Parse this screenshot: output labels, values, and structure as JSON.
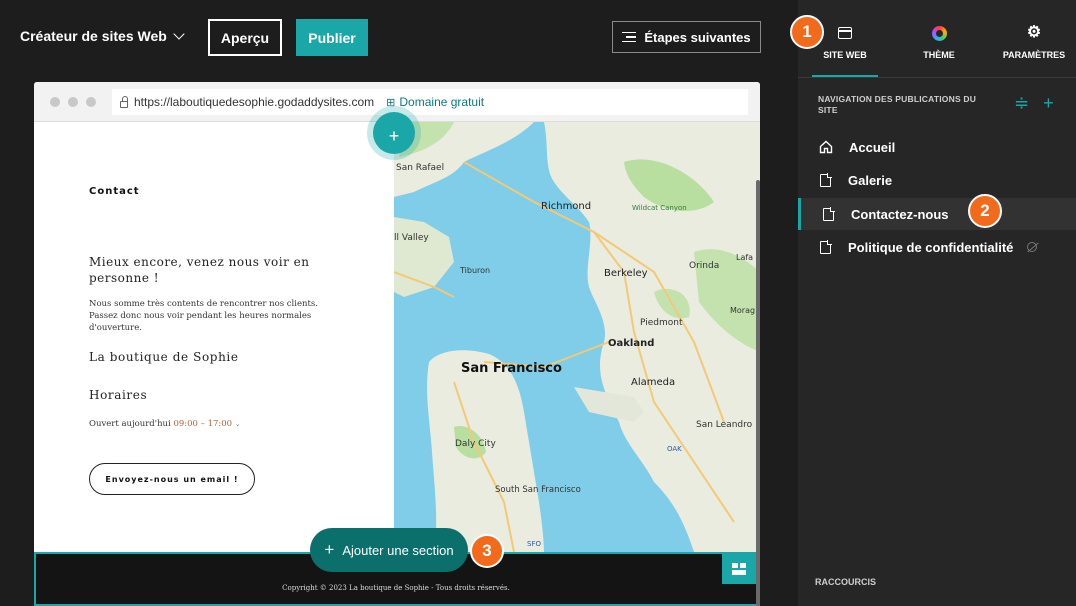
{
  "topbar": {
    "builder_title": "Créateur de sites Web",
    "preview_label": "Aperçu",
    "publish_label": "Publier",
    "next_steps_label": "Étapes suivantes"
  },
  "browser": {
    "url": "https://laboutiquedesophie.godaddysites.com",
    "domain_label": "Domaine gratuit"
  },
  "page": {
    "contact_heading": "Contact",
    "title": "Mieux encore, venez nous voir en personne !",
    "text": "Nous somme très contents de rencontrer nos clients. Passez donc nous voir pendant les heures normales d'ouverture.",
    "shop_name": "La boutique de Sophie",
    "hours_heading": "Horaires",
    "open_today": "Ouvert aujourd'hui",
    "open_time": "09:00 – 17:00",
    "email_button": "Envoyez-nous un email !",
    "footer_text": "Copyright © 2023 La boutique de Sophie - Tous droits réservés.",
    "add_section_label": "Ajouter une section"
  },
  "map": {
    "labels": {
      "san_rafael": "San Rafael",
      "richmond": "Richmond",
      "wildcat": "Wildcat Canyon",
      "tiburon": "Tiburon",
      "berkeley": "Berkeley",
      "orinda": "Orinda",
      "lafa": "Lafa",
      "piedmont": "Piedmont",
      "moraga": "Morag",
      "oakland": "Oakland",
      "san_francisco": "San Francisco",
      "alameda": "Alameda",
      "san_leandro": "San Leandro",
      "daly_city": "Daly City",
      "south_sf": "South San Francisco",
      "mill_valley": "ll Valley",
      "oak": "OAK",
      "sfo": "SFO"
    }
  },
  "panel": {
    "tabs": [
      {
        "label": "SITE WEB"
      },
      {
        "label": "THÈME"
      },
      {
        "label": "PARAMÈTRES"
      }
    ],
    "nav_heading": "NAVIGATION DES PUBLICATIONS DU SITE",
    "nav_items": [
      {
        "label": "Accueil"
      },
      {
        "label": "Galerie"
      },
      {
        "label": "Contactez-nous"
      },
      {
        "label": "Politique de confidentialité"
      }
    ],
    "shortcuts_label": "RACCOURCIS"
  },
  "badges": [
    "1",
    "2",
    "3"
  ],
  "colors": {
    "accent": "#1ba7a7",
    "badge": "#f26a1b",
    "background": "#1d1d1d",
    "panel": "#262626"
  }
}
